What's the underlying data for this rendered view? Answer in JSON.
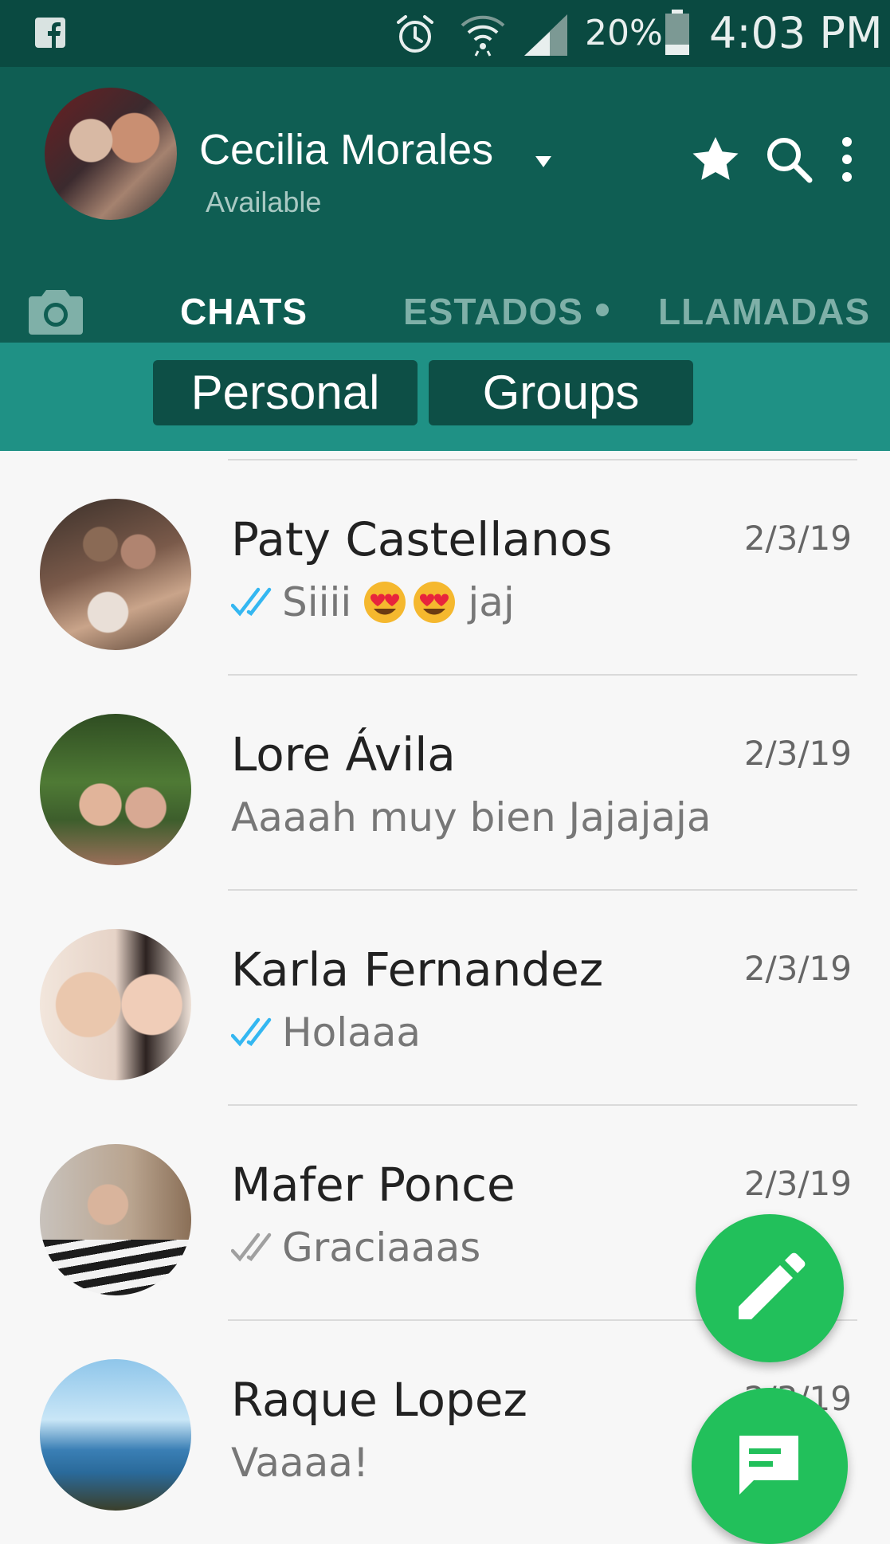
{
  "status_bar": {
    "battery_percent": "20%",
    "time": "4:03 PM",
    "icons": [
      "facebook-icon",
      "alarm-icon",
      "wifi-icon",
      "signal-icon",
      "battery-icon"
    ]
  },
  "header": {
    "profile_name": "Cecilia Morales",
    "profile_status": "Available",
    "actions": [
      "star-icon",
      "search-icon",
      "more-vert-icon"
    ]
  },
  "tabs": {
    "camera": "camera-icon",
    "items": [
      {
        "label": "CHATS",
        "active": true
      },
      {
        "label": "ESTADOS",
        "active": false,
        "badge_dot": true
      },
      {
        "label": "LLAMADAS",
        "active": false
      }
    ]
  },
  "filters": {
    "personal": "Personal",
    "groups": "Groups"
  },
  "chats": [
    {
      "name": "Paty Castellanos",
      "date": "2/3/19",
      "message": "Siiii",
      "message_tail": "jaj",
      "emojis": [
        "heart-eyes-emoji",
        "heart-eyes-emoji"
      ],
      "ticks": "read"
    },
    {
      "name": "Lore Ávila",
      "date": "2/3/19",
      "message": "Aaaah muy bien Jajajaja",
      "ticks": "none"
    },
    {
      "name": "Karla Fernandez",
      "date": "2/3/19",
      "message": "Holaaa",
      "ticks": "read"
    },
    {
      "name": "Mafer Ponce",
      "date": "2/3/19",
      "message": "Graciaaas",
      "ticks": "delivered"
    },
    {
      "name": "Raque Lopez",
      "date": "2/3/19",
      "message": "Vaaaa!",
      "ticks": "none"
    }
  ],
  "colors": {
    "status_bar": "#0a4a41",
    "header": "#0f5e53",
    "filter_bar": "#1f9185",
    "chip": "#0d4f46",
    "fab": "#22c05b",
    "read_ticks": "#34b7f1"
  },
  "fab": {
    "edit": "edit-icon",
    "message": "message-icon"
  }
}
